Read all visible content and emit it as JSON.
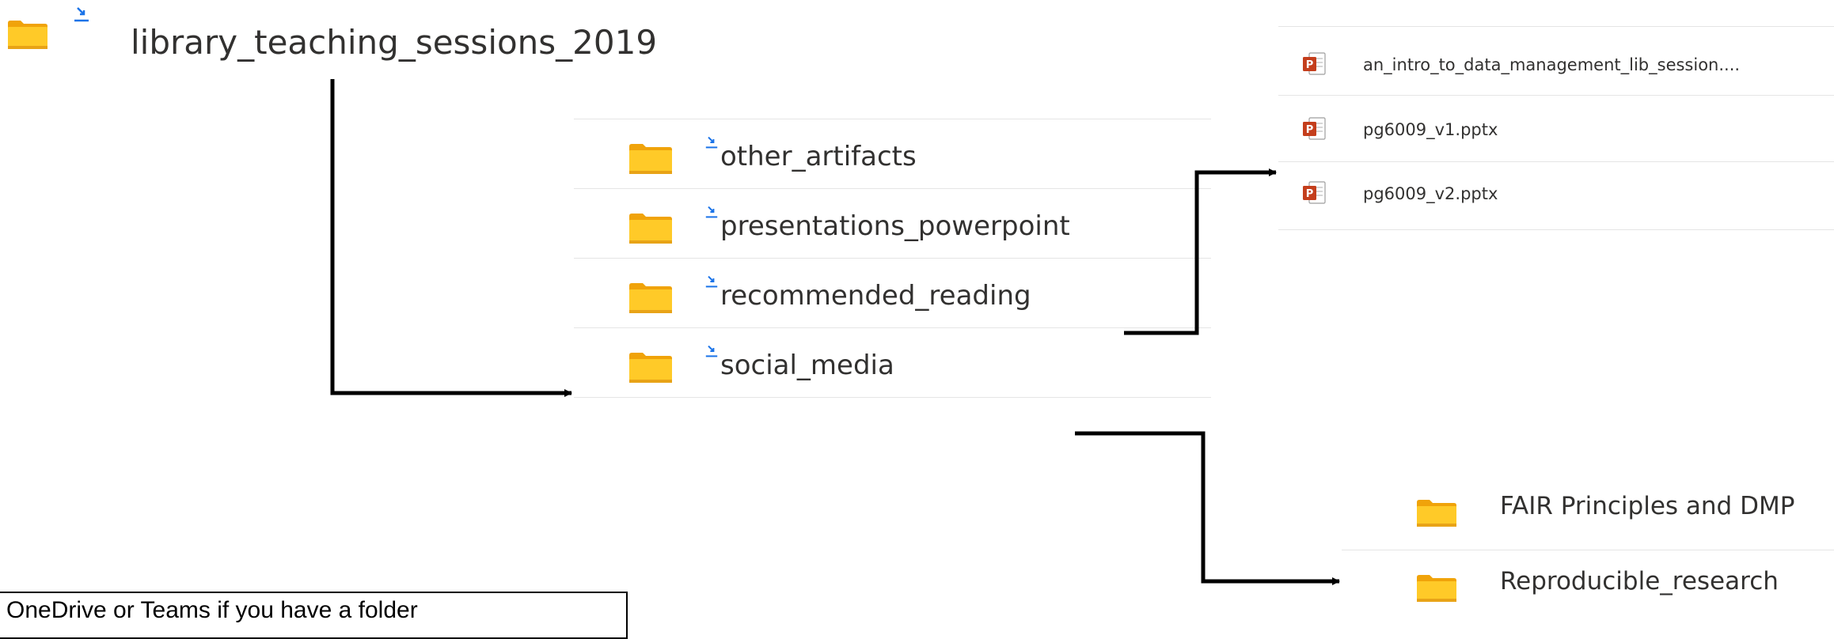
{
  "root_folder": {
    "name": "library_teaching_sessions_2019"
  },
  "subfolders": [
    {
      "name": "other_artifacts"
    },
    {
      "name": "presentations_powerpoint"
    },
    {
      "name": "recommended_reading"
    },
    {
      "name": "social_media"
    }
  ],
  "presentation_files": [
    {
      "name": "an_intro_to_data_management_lib_session...."
    },
    {
      "name": "pg6009_v1.pptx"
    },
    {
      "name": "pg6009_v2.pptx"
    }
  ],
  "reading_folders": [
    {
      "name": "FAIR Principles and DMP"
    },
    {
      "name": "Reproducible_research"
    }
  ],
  "note": {
    "text": "OneDrive or Teams if you have a folder"
  },
  "colors": {
    "folder_body": "#ffca28",
    "folder_back": "#f0a30a",
    "folder_base": "#e8a317",
    "sync_icon": "#1a73e8",
    "ppt_red": "#c43e1c",
    "divider": "#e5e5e5",
    "arrow": "#000000"
  }
}
